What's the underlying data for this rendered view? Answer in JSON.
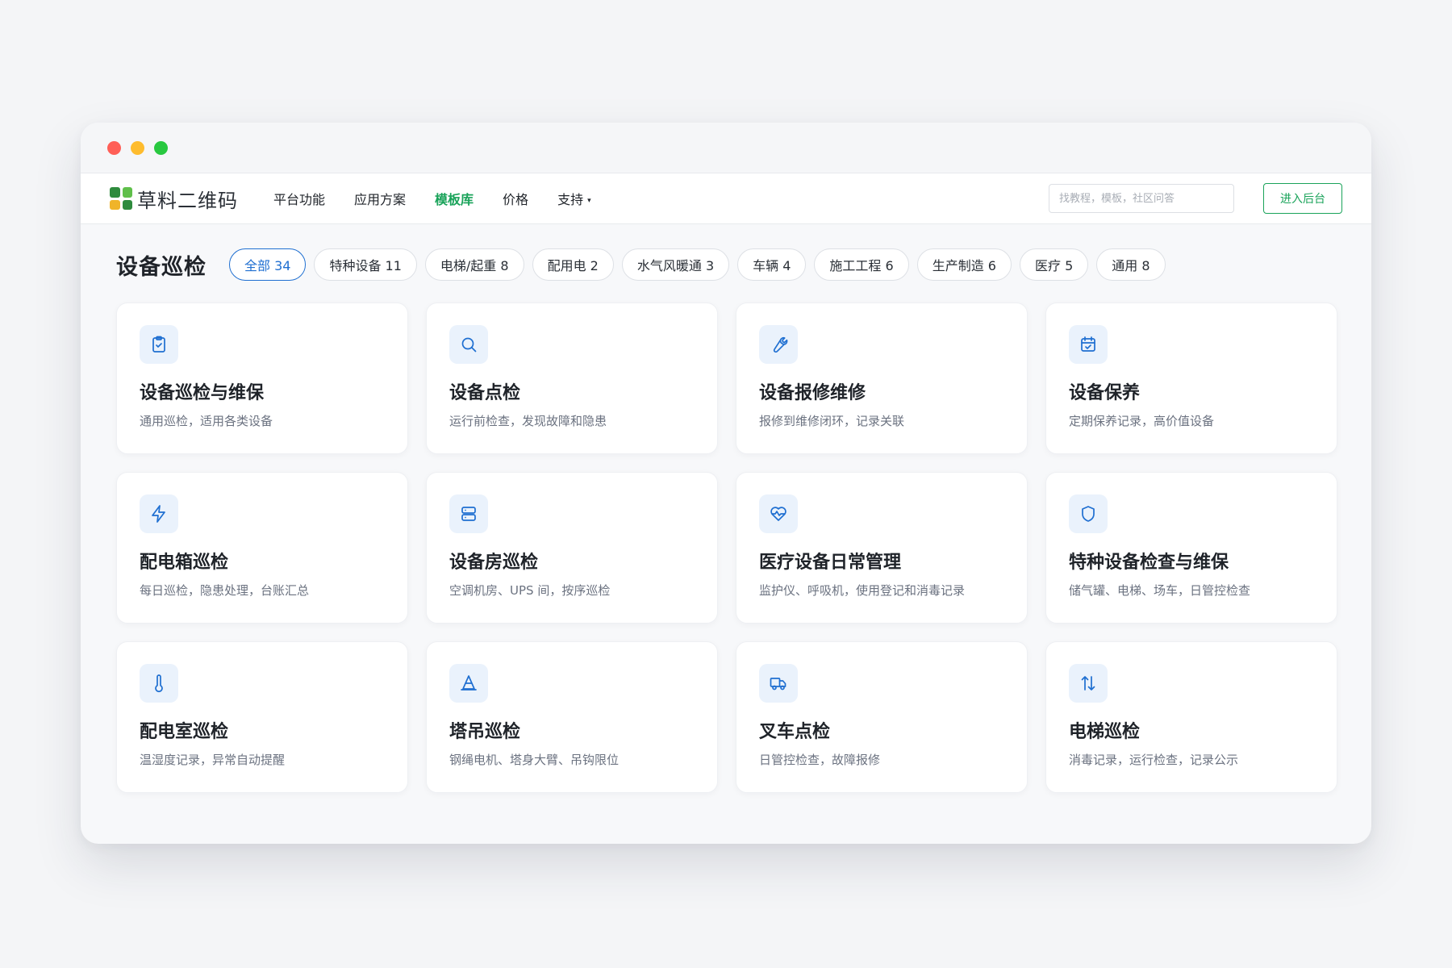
{
  "window": {
    "controls": [
      "close",
      "minimize",
      "maximize"
    ]
  },
  "brand": {
    "name": "草料二维码",
    "colors": [
      "#2e8b3d",
      "#5fbf4a",
      "#f0b429",
      "#2e8b3d"
    ]
  },
  "nav": {
    "items": [
      {
        "label": "平台功能",
        "active": false
      },
      {
        "label": "应用方案",
        "active": false
      },
      {
        "label": "模板库",
        "active": true
      },
      {
        "label": "价格",
        "active": false
      },
      {
        "label": "支持",
        "active": false,
        "has_dropdown": true
      }
    ],
    "dropdown_glyph": "▾",
    "search_placeholder": "找教程，模板，社区问答",
    "admin_button": "进入后台"
  },
  "page": {
    "title": "设备巡检",
    "filters": [
      {
        "label": "全部 34",
        "active": true
      },
      {
        "label": "特种设备 11",
        "active": false
      },
      {
        "label": "电梯/起重 8",
        "active": false
      },
      {
        "label": "配用电 2",
        "active": false
      },
      {
        "label": "水气风暖通 3",
        "active": false
      },
      {
        "label": "车辆 4",
        "active": false
      },
      {
        "label": "施工工程 6",
        "active": false
      },
      {
        "label": "生产制造 6",
        "active": false
      },
      {
        "label": "医疗 5",
        "active": false
      },
      {
        "label": "通用 8",
        "active": false
      }
    ]
  },
  "accent_colors": {
    "green": "#1aa35a",
    "blue": "#1f6fd1"
  },
  "templates": [
    {
      "icon": "clipboard-check-icon",
      "title": "设备巡检与维保",
      "desc": "通用巡检，适用各类设备"
    },
    {
      "icon": "search-icon",
      "title": "设备点检",
      "desc": "运行前检查，发现故障和隐患"
    },
    {
      "icon": "wrench-icon",
      "title": "设备报修维修",
      "desc": "报修到维修闭环，记录关联"
    },
    {
      "icon": "calendar-check-icon",
      "title": "设备保养",
      "desc": "定期保养记录，高价值设备"
    },
    {
      "icon": "lightning-icon",
      "title": "配电箱巡检",
      "desc": "每日巡检，隐患处理，台账汇总"
    },
    {
      "icon": "server-icon",
      "title": "设备房巡检",
      "desc": "空调机房、UPS 间，按序巡检"
    },
    {
      "icon": "heart-pulse-icon",
      "title": "医疗设备日常管理",
      "desc": "监护仪、呼吸机，使用登记和消毒记录"
    },
    {
      "icon": "shield-icon",
      "title": "特种设备检查与维保",
      "desc": "储气罐、电梯、场车，日管控检查"
    },
    {
      "icon": "thermometer-icon",
      "title": "配电室巡检",
      "desc": "温湿度记录，异常自动提醒"
    },
    {
      "icon": "cone-icon",
      "title": "塔吊巡检",
      "desc": "钢绳电机、塔身大臂、吊钩限位"
    },
    {
      "icon": "truck-icon",
      "title": "叉车点检",
      "desc": "日管控检查，故障报修"
    },
    {
      "icon": "arrows-up-down-icon",
      "title": "电梯巡检",
      "desc": "消毒记录，运行检查，记录公示"
    }
  ]
}
